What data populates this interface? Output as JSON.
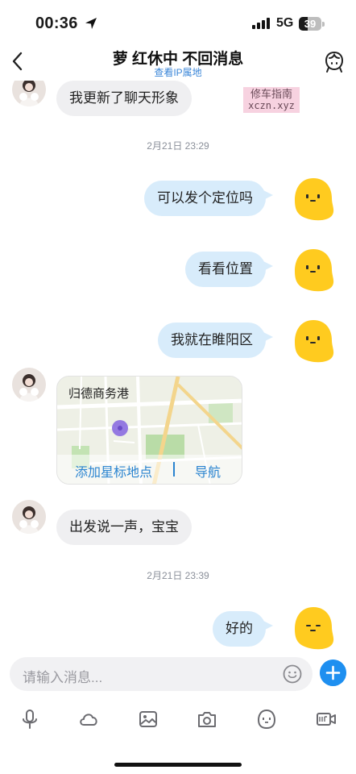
{
  "status_bar": {
    "time": "00:36",
    "network": "5G",
    "battery": "39",
    "battery_level": 0.39
  },
  "header": {
    "title": "萝 红休中 不回消息",
    "subtitle": "查看IP属地"
  },
  "watermark": {
    "line1": "修车指南",
    "line2": "xczn.xyz"
  },
  "messages": {
    "m0": "我更新了聊天形象",
    "t1": "2月21日 23:29",
    "m1": "可以发个定位吗",
    "m2": "看看位置",
    "m3": "我就在睢阳区",
    "map": {
      "name": "归德商务港",
      "add_star": "添加星标地点",
      "navigate": "导航"
    },
    "m4": "出发说一声，宝宝",
    "t2": "2月21日 23:39",
    "m5": "好的"
  },
  "input": {
    "placeholder": "请输入消息..."
  },
  "toolbar": {
    "icons": [
      "mic-icon",
      "cloud-icon",
      "image-icon",
      "camera-icon",
      "face-icon",
      "gif-icon"
    ]
  },
  "colors": {
    "accent": "#1e8ff0",
    "outgoing_bubble": "#d8ecfb",
    "incoming_bubble": "#efeff1",
    "link": "#3a86d8",
    "avatar_yellow": "#ffcb1f"
  }
}
